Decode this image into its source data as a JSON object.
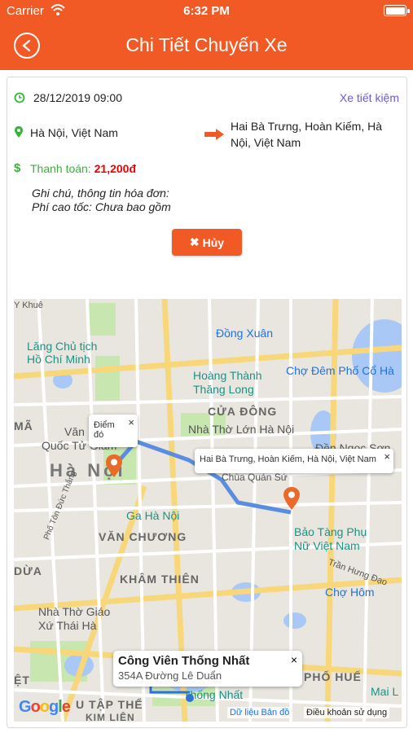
{
  "status_bar": {
    "carrier": "Carrier",
    "time": "6:32 PM"
  },
  "header": {
    "title": "Chi Tiết Chuyến Xe",
    "back_icon": "back-arrow-icon"
  },
  "trip": {
    "datetime": "28/12/2019 09:00",
    "vehicle_type": "Xe tiết kiệm",
    "origin": "Hà Nội, Việt Nam",
    "destination": "Hai Bà Trưng, Hoàn Kiếm, Hà Nội, Việt Nam",
    "payment_label": "Thanh toán:",
    "payment_amount": "21,200đ",
    "note_line1": "Ghi chú, thông tin hóa đơn:",
    "note_line2": "Phí cao tốc: Chưa bao gồm",
    "cancel_label": "Hủy"
  },
  "map": {
    "origin_bubble": "Điểm đó",
    "destination_bubble": "Hai Bà Trưng, Hoàn Kiếm, Hà Nội, Việt Nam",
    "close_symbol": "×",
    "labels": {
      "dong_xuan": "Đồng Xuân",
      "lang_chu_tich_1": "Lăng Chủ tịch",
      "lang_chu_tich_2": "Hồ Chí Minh",
      "hoang_thanh_1": "Hoàng Thành",
      "hoang_thanh_2": "Thăng Long",
      "cho_dem": "Chợ Đêm Phố Cổ Hà",
      "cua_dong": "CỬA ĐÔNG",
      "nha_tho_lon": "Nhà Thờ Lớn Hà Nội",
      "den_ngoc_son": "Đền Ngọc Sơn",
      "van_mieu_1": "Văn",
      "van_mieu_2": "Quốc Tử Giám",
      "ha_noi": "Hà Nội",
      "chua_quan_su": "Chùa Quán Sứ",
      "ga_ha_noi": "Ga Hà Nội",
      "van_chuong": "VĂN CHƯƠNG",
      "bao_tang_1": "Bảo Tàng Phụ",
      "bao_tang_2": "Nữ Việt Nam",
      "tran_hung_dao": "Trần Hưng Đạo",
      "pho_ton_duc_thang": "Phố Tôn Đức Thắng",
      "kham_thien": "KHÂM THIÊN",
      "cho_hom": "Chợ Hôm",
      "nha_tho_giao_1": "Nhà Thờ Giáo",
      "nha_tho_giao_2": "Xứ Thái Hà",
      "pho_hue": "PHỐ HUẾ",
      "mai_l": "Mai L",
      "dua": "DỪA",
      "hang_dau": "Y Khuê",
      "tap_the": "U TẬP THỂ",
      "kim_lien": "KIM LIÊN",
      "et": "ỆT",
      "ma": "MÃ",
      "thong_nhat": "Thống Nhất"
    },
    "place_card": {
      "name": "Công Viên Thống Nhất",
      "address": "354A Đường Lê Duẩn"
    },
    "attribution_data": "Dữ liệu Bản đồ",
    "attribution_terms": "Điều khoản sử dụng",
    "logo": "Google"
  },
  "colors": {
    "accent": "#f15a24",
    "route": "#5a8de0",
    "pin": "#ea6a2a"
  }
}
